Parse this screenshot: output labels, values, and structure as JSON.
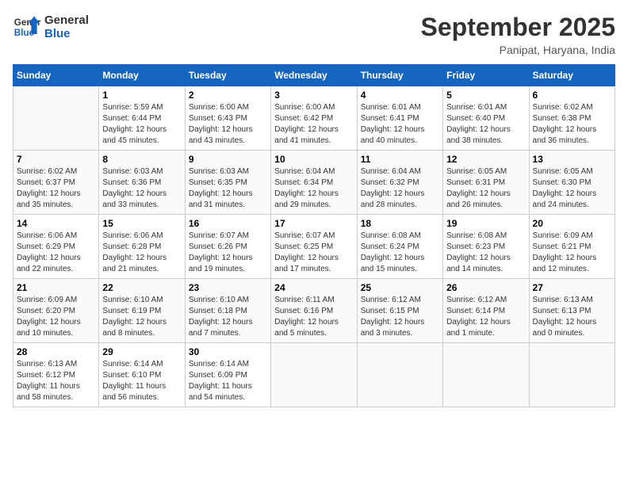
{
  "logo": {
    "line1": "General",
    "line2": "Blue"
  },
  "title": "September 2025",
  "location": "Panipat, Haryana, India",
  "weekdays": [
    "Sunday",
    "Monday",
    "Tuesday",
    "Wednesday",
    "Thursday",
    "Friday",
    "Saturday"
  ],
  "weeks": [
    [
      {
        "day": "",
        "info": ""
      },
      {
        "day": "1",
        "info": "Sunrise: 5:59 AM\nSunset: 6:44 PM\nDaylight: 12 hours\nand 45 minutes."
      },
      {
        "day": "2",
        "info": "Sunrise: 6:00 AM\nSunset: 6:43 PM\nDaylight: 12 hours\nand 43 minutes."
      },
      {
        "day": "3",
        "info": "Sunrise: 6:00 AM\nSunset: 6:42 PM\nDaylight: 12 hours\nand 41 minutes."
      },
      {
        "day": "4",
        "info": "Sunrise: 6:01 AM\nSunset: 6:41 PM\nDaylight: 12 hours\nand 40 minutes."
      },
      {
        "day": "5",
        "info": "Sunrise: 6:01 AM\nSunset: 6:40 PM\nDaylight: 12 hours\nand 38 minutes."
      },
      {
        "day": "6",
        "info": "Sunrise: 6:02 AM\nSunset: 6:38 PM\nDaylight: 12 hours\nand 36 minutes."
      }
    ],
    [
      {
        "day": "7",
        "info": "Sunrise: 6:02 AM\nSunset: 6:37 PM\nDaylight: 12 hours\nand 35 minutes."
      },
      {
        "day": "8",
        "info": "Sunrise: 6:03 AM\nSunset: 6:36 PM\nDaylight: 12 hours\nand 33 minutes."
      },
      {
        "day": "9",
        "info": "Sunrise: 6:03 AM\nSunset: 6:35 PM\nDaylight: 12 hours\nand 31 minutes."
      },
      {
        "day": "10",
        "info": "Sunrise: 6:04 AM\nSunset: 6:34 PM\nDaylight: 12 hours\nand 29 minutes."
      },
      {
        "day": "11",
        "info": "Sunrise: 6:04 AM\nSunset: 6:32 PM\nDaylight: 12 hours\nand 28 minutes."
      },
      {
        "day": "12",
        "info": "Sunrise: 6:05 AM\nSunset: 6:31 PM\nDaylight: 12 hours\nand 26 minutes."
      },
      {
        "day": "13",
        "info": "Sunrise: 6:05 AM\nSunset: 6:30 PM\nDaylight: 12 hours\nand 24 minutes."
      }
    ],
    [
      {
        "day": "14",
        "info": "Sunrise: 6:06 AM\nSunset: 6:29 PM\nDaylight: 12 hours\nand 22 minutes."
      },
      {
        "day": "15",
        "info": "Sunrise: 6:06 AM\nSunset: 6:28 PM\nDaylight: 12 hours\nand 21 minutes."
      },
      {
        "day": "16",
        "info": "Sunrise: 6:07 AM\nSunset: 6:26 PM\nDaylight: 12 hours\nand 19 minutes."
      },
      {
        "day": "17",
        "info": "Sunrise: 6:07 AM\nSunset: 6:25 PM\nDaylight: 12 hours\nand 17 minutes."
      },
      {
        "day": "18",
        "info": "Sunrise: 6:08 AM\nSunset: 6:24 PM\nDaylight: 12 hours\nand 15 minutes."
      },
      {
        "day": "19",
        "info": "Sunrise: 6:08 AM\nSunset: 6:23 PM\nDaylight: 12 hours\nand 14 minutes."
      },
      {
        "day": "20",
        "info": "Sunrise: 6:09 AM\nSunset: 6:21 PM\nDaylight: 12 hours\nand 12 minutes."
      }
    ],
    [
      {
        "day": "21",
        "info": "Sunrise: 6:09 AM\nSunset: 6:20 PM\nDaylight: 12 hours\nand 10 minutes."
      },
      {
        "day": "22",
        "info": "Sunrise: 6:10 AM\nSunset: 6:19 PM\nDaylight: 12 hours\nand 8 minutes."
      },
      {
        "day": "23",
        "info": "Sunrise: 6:10 AM\nSunset: 6:18 PM\nDaylight: 12 hours\nand 7 minutes."
      },
      {
        "day": "24",
        "info": "Sunrise: 6:11 AM\nSunset: 6:16 PM\nDaylight: 12 hours\nand 5 minutes."
      },
      {
        "day": "25",
        "info": "Sunrise: 6:12 AM\nSunset: 6:15 PM\nDaylight: 12 hours\nand 3 minutes."
      },
      {
        "day": "26",
        "info": "Sunrise: 6:12 AM\nSunset: 6:14 PM\nDaylight: 12 hours\nand 1 minute."
      },
      {
        "day": "27",
        "info": "Sunrise: 6:13 AM\nSunset: 6:13 PM\nDaylight: 12 hours\nand 0 minutes."
      }
    ],
    [
      {
        "day": "28",
        "info": "Sunrise: 6:13 AM\nSunset: 6:12 PM\nDaylight: 11 hours\nand 58 minutes."
      },
      {
        "day": "29",
        "info": "Sunrise: 6:14 AM\nSunset: 6:10 PM\nDaylight: 11 hours\nand 56 minutes."
      },
      {
        "day": "30",
        "info": "Sunrise: 6:14 AM\nSunset: 6:09 PM\nDaylight: 11 hours\nand 54 minutes."
      },
      {
        "day": "",
        "info": ""
      },
      {
        "day": "",
        "info": ""
      },
      {
        "day": "",
        "info": ""
      },
      {
        "day": "",
        "info": ""
      }
    ]
  ]
}
